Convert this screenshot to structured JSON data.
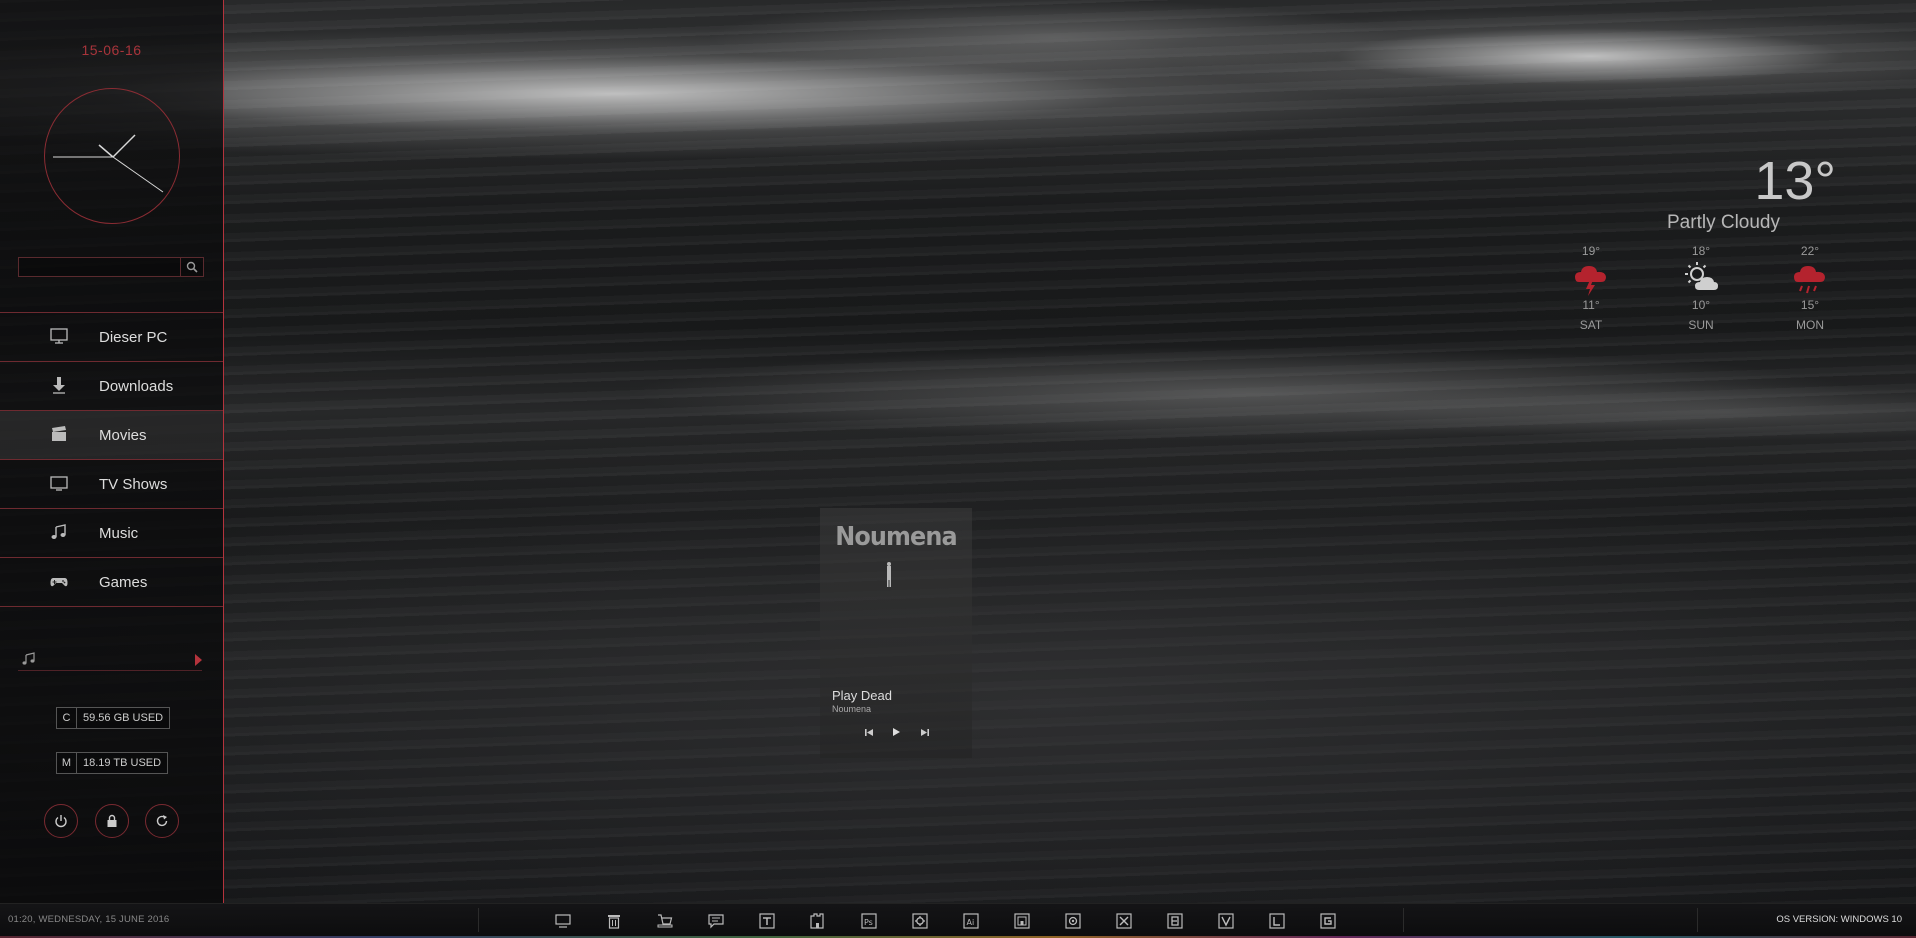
{
  "sidebar": {
    "date": "15-06-16",
    "search": {
      "placeholder": "",
      "value": ""
    },
    "nav": [
      {
        "label": "Dieser PC",
        "icon": "monitor-icon"
      },
      {
        "label": "Downloads",
        "icon": "download-icon"
      },
      {
        "label": "Movies",
        "icon": "clapperboard-icon",
        "active": true
      },
      {
        "label": "TV Shows",
        "icon": "tv-icon"
      },
      {
        "label": "Music",
        "icon": "music-note-icon"
      },
      {
        "label": "Games",
        "icon": "gamepad-icon"
      }
    ],
    "drives": [
      {
        "letter": "C",
        "used": "59.56 GB USED"
      },
      {
        "letter": "M",
        "used": "18.19 TB USED"
      }
    ],
    "power_buttons": [
      "power-icon",
      "lock-icon",
      "restart-icon"
    ]
  },
  "weather": {
    "temperature": "13°",
    "condition": "Partly Cloudy",
    "forecast": [
      {
        "high": "19°",
        "low": "11°",
        "day": "SAT",
        "icon": "thunderstorm-icon",
        "icon_color": "#b4232e"
      },
      {
        "high": "18°",
        "low": "10°",
        "day": "SUN",
        "icon": "sun-cloud-icon",
        "icon_color": "#cfcfcf"
      },
      {
        "high": "22°",
        "low": "15°",
        "day": "MON",
        "icon": "rain-icon",
        "icon_color": "#b4232e"
      }
    ]
  },
  "player": {
    "album_logo": "Noumena",
    "track": "Play Dead",
    "artist": "Noumena",
    "controls": [
      "previous-icon",
      "play-icon",
      "next-icon"
    ]
  },
  "taskbar": {
    "datetime": "01:20, WEDNESDAY, 15 JUNE 2016",
    "os_version": "OS VERSION: WINDOWS 10",
    "icons": [
      "desktop-icon",
      "trash-icon",
      "cart-icon",
      "chat-icon",
      "text-icon",
      "building-icon",
      "photoshop-icon",
      "gear-icon",
      "illustrator-icon",
      "image-icon",
      "camera-icon",
      "close-box-icon",
      "b-icon",
      "v-icon",
      "l-icon",
      "g-icon"
    ]
  },
  "colors": {
    "accent": "#b4333c",
    "text": "#dddddd"
  }
}
